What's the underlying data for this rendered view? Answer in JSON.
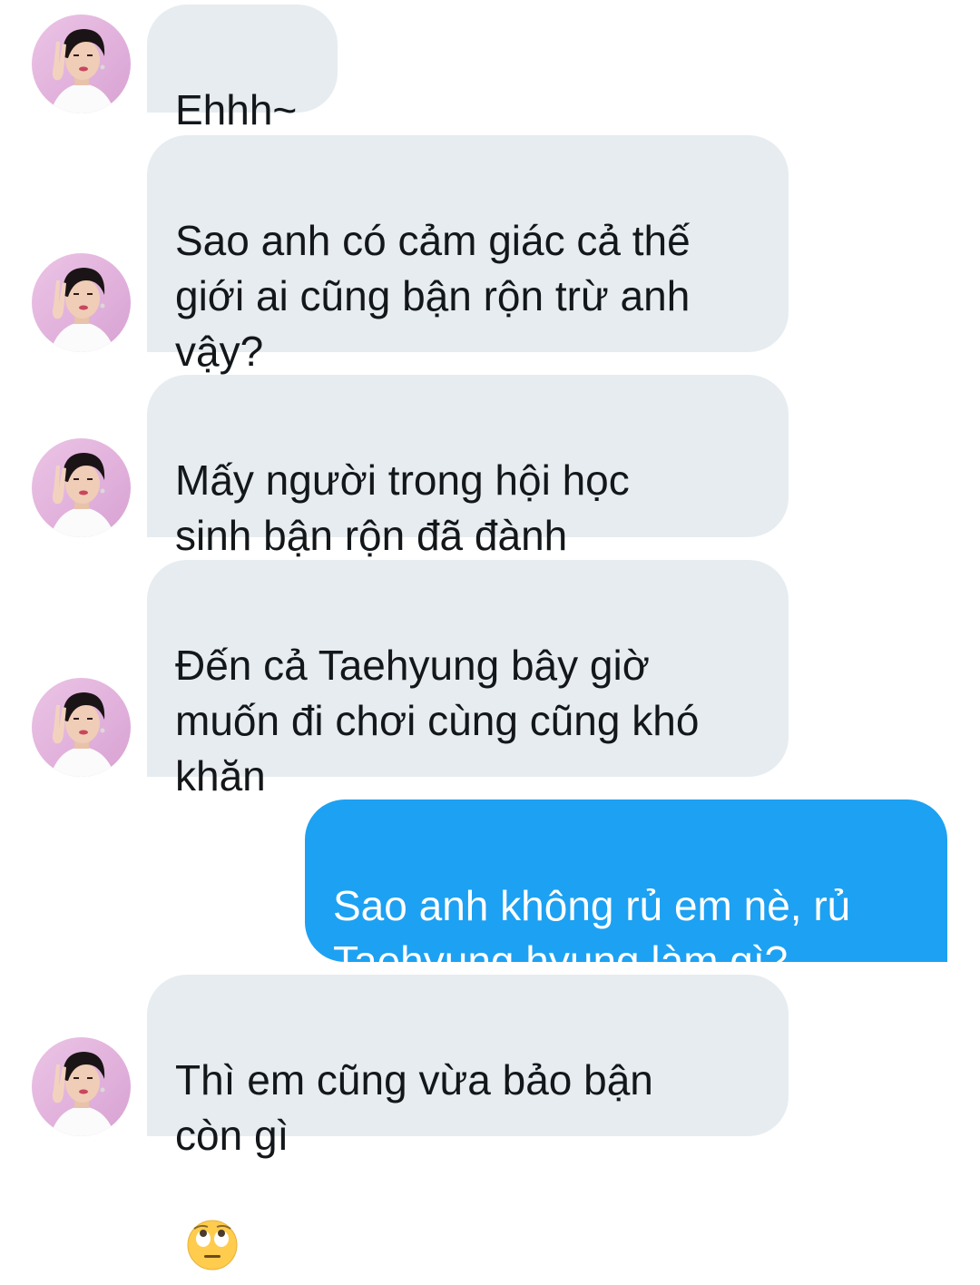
{
  "conversation": {
    "messages": [
      {
        "from": "other",
        "text": "Ehhh~"
      },
      {
        "from": "other",
        "text": "Sao anh có cảm giác cả thế\ngiới ai cũng bận rộn trừ anh\nvậy?"
      },
      {
        "from": "other",
        "text": "Mấy người trong hội học\nsinh bận rộn đã đành"
      },
      {
        "from": "other",
        "text": "Đến cả Taehyung bây giờ\nmuốn đi chơi cùng cũng khó\nkhăn"
      },
      {
        "from": "me",
        "text": "Sao anh không rủ em nè, rủ\nTaehyung hyung làm gì?"
      },
      {
        "from": "other",
        "text": "Thì em cũng vừa bảo bận\ncòn gì",
        "emoji": "🙄"
      }
    ]
  },
  "colors": {
    "incoming_bubble": "#e6ecf0",
    "outgoing_bubble": "#1da1f2",
    "incoming_text": "#14171a",
    "outgoing_text": "#ffffff"
  },
  "icons": {
    "avatar": "contact-avatar-photo",
    "emoji": "face-with-rolling-eyes"
  }
}
